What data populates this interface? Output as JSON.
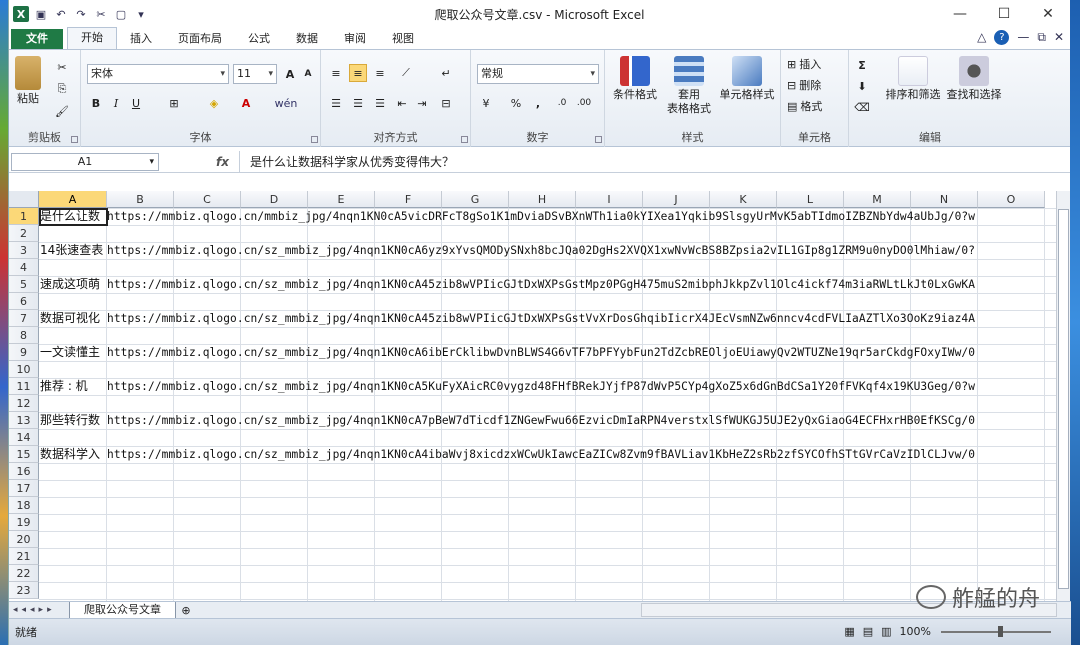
{
  "window": {
    "title": "爬取公众号文章.csv - Microsoft Excel"
  },
  "titlebar": {
    "minimize": "—",
    "maximize": "☐",
    "close": "✕"
  },
  "tabs": [
    "文件",
    "开始",
    "插入",
    "页面布局",
    "公式",
    "数据",
    "审阅",
    "视图"
  ],
  "ribbon": {
    "clipboard": {
      "label": "剪贴板",
      "paste": "粘贴"
    },
    "font": {
      "label": "字体",
      "name": "宋体",
      "size": "11",
      "grow": "A",
      "shrink": "A",
      "bold": "B",
      "italic": "I",
      "underline": "U"
    },
    "alignment": {
      "label": "对齐方式"
    },
    "number": {
      "label": "数字",
      "format": "常规",
      "percent": "%",
      "comma": ","
    },
    "styles": {
      "label": "样式",
      "conditional": "条件格式",
      "table": "套用\n表格格式",
      "cell": "单元格样式"
    },
    "cells": {
      "label": "单元格",
      "insert": "插入",
      "delete": "删除",
      "format": "格式"
    },
    "editing": {
      "label": "编辑",
      "sum": "Σ",
      "sort": "排序和筛选",
      "find": "查找和选择"
    }
  },
  "formula_bar": {
    "name_box": "A1",
    "fx": "fx",
    "content": "是什么让数据科学家从优秀变得伟大？"
  },
  "columns": [
    "A",
    "B",
    "C",
    "D",
    "E",
    "F",
    "G",
    "H",
    "I",
    "J",
    "K",
    "L",
    "M",
    "N",
    "O"
  ],
  "rows": [
    "1",
    "2",
    "3",
    "4",
    "5",
    "6",
    "7",
    "8",
    "9",
    "10",
    "11",
    "12",
    "13",
    "14",
    "15",
    "16",
    "17",
    "18",
    "19",
    "20",
    "21",
    "22",
    "23"
  ],
  "cells": [
    {
      "row": 1,
      "a": "是什么让数",
      "b": "https://mmbiz.qlogo.cn/mmbiz_jpg/4nqn1KN0cA5vicDRFcT8gSo1K1mDviaDSvBXnWTh1ia0kYIXea1Yqkib9SlsgyUrMvK5abTIdmoIZBZNbYdw4aUbJg/0?w"
    },
    {
      "row": 3,
      "a": "14张速查表",
      "b": "https://mmbiz.qlogo.cn/sz_mmbiz_jpg/4nqn1KN0cA6yz9xYvsQMODySNxh8bcJQa02DgHs2XVQX1xwNvWcBS8BZpsia2vIL1GIp8g1ZRM9u0nyDO0lMhiaw/0?"
    },
    {
      "row": 5,
      "a": "速成这项萌",
      "b": "https://mmbiz.qlogo.cn/sz_mmbiz_jpg/4nqn1KN0cA45zib8wVPIicGJtDxWXPsGstMpz0PGgH475muS2mibphJkkpZvl1Olc4ickf74m3iaRWLtLkJt0LxGwKA"
    },
    {
      "row": 7,
      "a": "数据可视化",
      "b": "https://mmbiz.qlogo.cn/sz_mmbiz_jpg/4nqn1KN0cA45zib8wVPIicGJtDxWXPsGstVvXrDosGhqibIicrX4JEcVsmNZw6nncv4cdFVLIaAZTlXo3OoKz9iaz4A"
    },
    {
      "row": 9,
      "a": "一文读懂主",
      "b": "https://mmbiz.qlogo.cn/sz_mmbiz_jpg/4nqn1KN0cA6ibErCklibwDvnBLWS4G6vTF7bPFYybFun2TdZcbREOljoEUiawyQv2WTUZNe19qr5arCkdgFOxyIWw/0"
    },
    {
      "row": 11,
      "a": "推荐 : 机",
      "b": "https://mmbiz.qlogo.cn/sz_mmbiz_jpg/4nqn1KN0cA5KuFyXAicRC0vygzd48FHfBRekJYjfP87dWvP5CYp4gXoZ5x6dGnBdCSa1Y20fFVKqf4x19KU3Geg/0?w"
    },
    {
      "row": 13,
      "a": "那些转行数",
      "b": "https://mmbiz.qlogo.cn/sz_mmbiz_jpg/4nqn1KN0cA7pBeW7dTicdf1ZNGewFwu66EzvicDmIaRPN4verstxlSfWUKGJ5UJE2yQxGiaoG4ECFHxrHB0EfKSCg/0"
    },
    {
      "row": 15,
      "a": "数据科学入",
      "b": "https://mmbiz.qlogo.cn/sz_mmbiz_jpg/4nqn1KN0cA4ibaWvj8xicdzxWCwUkIawcEaZICw8Zvm9fBAVLiav1KbHeZ2sRb2zfSYCOfhSTtGVrCaVzIDlCLJvw/0"
    }
  ],
  "sheet_tab": "爬取公众号文章",
  "status": "就绪",
  "zoom": "100%",
  "watermark": "舴艋的舟"
}
